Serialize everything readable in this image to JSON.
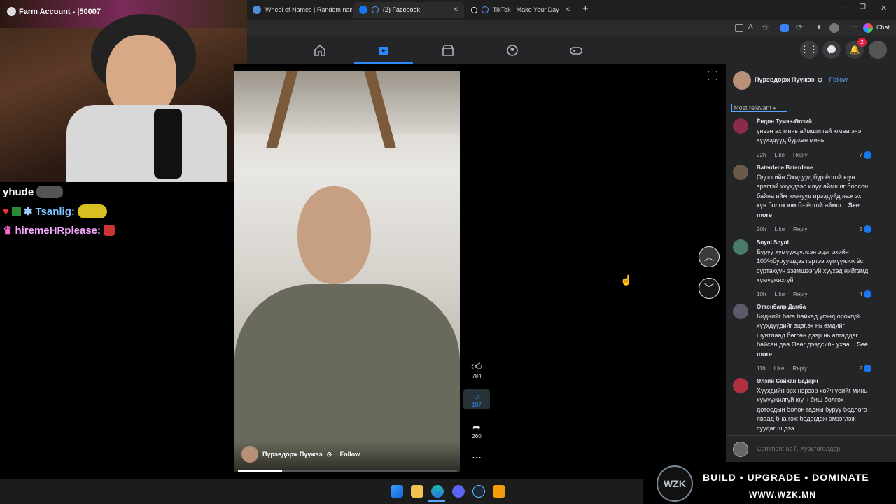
{
  "browser": {
    "tabs": [
      {
        "label": "Wheel of Names | Random name",
        "active": false
      },
      {
        "label": "(2) Facebook",
        "active": true
      },
      {
        "label": "TikTok - Make Your Day",
        "active": false
      }
    ],
    "chat_button": "Chat"
  },
  "webcam": {
    "overlay": "Farm Account - |50007"
  },
  "stream_chat": [
    {
      "user": "yhude",
      "message": ""
    },
    {
      "user": "Tsanlig:",
      "message": ""
    },
    {
      "user": "hiremeHRplease:",
      "message": ""
    }
  ],
  "facebook": {
    "nav": [
      "home-icon",
      "video-icon",
      "marketplace-icon",
      "groups-icon",
      "gaming-icon"
    ],
    "notification_count": "2",
    "video": {
      "author": "Пүрэвдорж Пүүжээ",
      "follow": "· Follow",
      "likes": "784",
      "comments": "107",
      "shares": "260",
      "progress": 0.2
    },
    "panel": {
      "author": "Пүрэвдорж Пүүжээ",
      "follow": "· Follow",
      "sort": "Most relevant",
      "comment_placeholder": "Comment as Г. Хувьтөгөлдөр"
    },
    "comments": [
      {
        "name": "Ёндон Тумэн-Өлзий",
        "text": "үнээн ах минь аймшигтай юмаа энэ хүүхэдүүд бурхан минь",
        "see_more": "",
        "time": "22h",
        "like": "Like",
        "reply": "Reply",
        "reactions": "7",
        "avatar_color": "#8b2a4a"
      },
      {
        "name": "Baterdene Baterdene",
        "text": "Одоогийн Охидууд бүр ёстой юун эрэгтэй хүүхдээс илүү аймшиг болсон байна ийм юмнууд ирээдүйд яаж эх хүн болох юм бэ ёстой аймш...",
        "see_more": "See more",
        "time": "20h",
        "like": "Like",
        "reply": "Reply",
        "reactions": "5",
        "avatar_color": "#6a5a4a"
      },
      {
        "name": "Soyol Soyol",
        "text": "Буруу хүмүүжүүлсэн эцэг эхийн 100%буруушдээ гэртээ хүмүүжиж ёс суртахуун ээзмшээгүй хүүхэд нийгэмд хүмүүжихгүй",
        "see_more": "",
        "time": "10h",
        "like": "Like",
        "reply": "Reply",
        "reactions": "4",
        "avatar_color": "#4a7a6a"
      },
      {
        "name": "Оттонбаяр Дамба",
        "text": "Биднийг бага байхад үгэнд орохгүй хүүхдүүдийг эцэг,эх нь өмдийг шувтлаад бөгсөн дээр нь алгаддаг байсан даа.Өвөг дээдсийн ухаа...",
        "see_more": "See more",
        "time": "11h",
        "like": "Like",
        "reply": "Reply",
        "reactions": "2",
        "avatar_color": "#5a5a6a"
      },
      {
        "name": "Өлзий Сайхан Бадарч",
        "text": "Хүүхдийн эрх нэрээр хойч үеийг минь хүмүүжилгүй юу ч биш болгох дотоодын болон гадны буруу бодлого яваад бна гэж бодогдож эмзэглэж суудаг ш дээ.",
        "see_more": "",
        "time": "",
        "like": "",
        "reply": "",
        "reactions": "",
        "avatar_color": "#b03040"
      }
    ]
  },
  "watermark": {
    "logo": "WZK",
    "slogan": "BUILD • UPGRADE • DOMINATE",
    "url": "WWW.WZK.MN"
  },
  "taskbar": [
    "start-icon",
    "file-explorer-icon",
    "edge-icon",
    "discord-icon",
    "steam-icon",
    "app-icon"
  ]
}
